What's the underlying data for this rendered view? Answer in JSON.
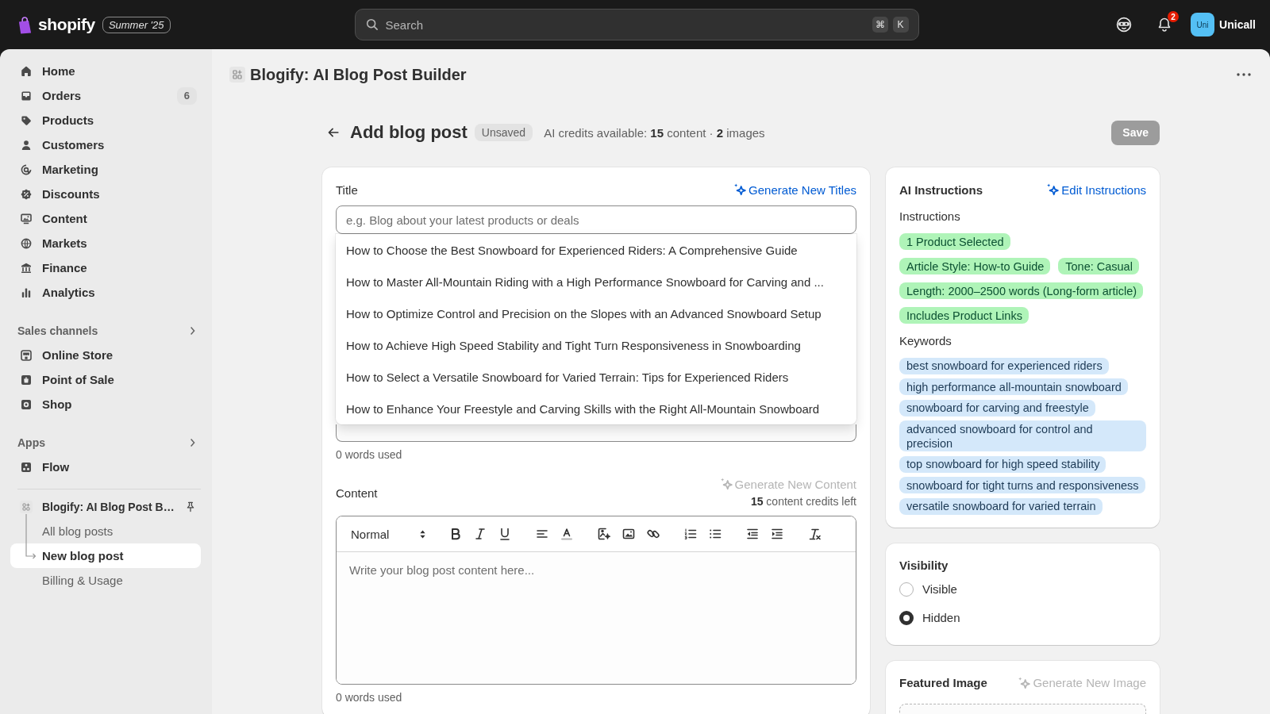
{
  "top_bar": {
    "logo_text": "shopify",
    "edition_badge": "Summer '25",
    "search": {
      "placeholder": "Search",
      "shortcut_keys": [
        "⌘",
        "K"
      ]
    },
    "notification_count": "2",
    "avatar_initials": "Uni",
    "store_name": "Unicall"
  },
  "sidebar": {
    "items": [
      {
        "label": "Home",
        "selected": false
      },
      {
        "label": "Orders",
        "badge": "6",
        "selected": false
      },
      {
        "label": "Products",
        "selected": false
      },
      {
        "label": "Customers",
        "selected": false
      },
      {
        "label": "Marketing",
        "selected": false
      },
      {
        "label": "Discounts",
        "selected": false
      },
      {
        "label": "Content",
        "selected": false
      },
      {
        "label": "Markets",
        "selected": false
      },
      {
        "label": "Finance",
        "selected": false
      },
      {
        "label": "Analytics",
        "selected": false
      }
    ],
    "sections": [
      {
        "title": "Sales channels",
        "items": [
          {
            "label": "Online Store",
            "selected": false
          },
          {
            "label": "Point of Sale",
            "selected": false
          },
          {
            "label": "Shop",
            "selected": false
          }
        ]
      },
      {
        "title": "Apps",
        "items": [
          {
            "label": "Flow",
            "selected": false
          }
        ]
      }
    ],
    "app": {
      "label": "Blogify: AI Blog Post B…",
      "selected": false,
      "children": [
        {
          "label": "All blog posts",
          "selected": false
        },
        {
          "label": "New blog post",
          "selected": true
        },
        {
          "label": "Billing & Usage",
          "selected": false
        }
      ]
    }
  },
  "app_header": {
    "title": "Blogify: AI Blog Post Builder"
  },
  "page_header": {
    "title": "Add blog post",
    "status_badge": "Unsaved",
    "credits_text": "AI credits available: **15** content · **2** images",
    "save_button": {
      "label": "Save",
      "disabled": true
    }
  },
  "post_form": {
    "title_field": {
      "label": "Title",
      "generate_link": {
        "label": "Generate New Titles",
        "disabled": false
      },
      "placeholder": "e.g. Blog about your latest products or deals",
      "suggestions": [
        "How to Choose the Best Snowboard for Experienced Riders: A Comprehensive Guide",
        "How to Master All-Mountain Riding with a High Performance Snowboard for Carving and ...",
        "How to Optimize Control and Precision on the Slopes with an Advanced Snowboard Setup",
        "How to Achieve High Speed Stability and Tight Turn Responsiveness in Snowboarding",
        "How to Select a Versatile Snowboard for Varied Terrain: Tips for Experienced Riders",
        "How to Enhance Your Freestyle and Carving Skills with the Right All-Mountain Snowboard"
      ]
    },
    "covered_field": {
      "word_count": "0 words used"
    },
    "content_field": {
      "label": "Content",
      "generate_link": {
        "label": "Generate New Content",
        "disabled": true
      },
      "credits_text": "**15** content credits left",
      "format_select": "Normal",
      "placeholder": "Write your blog post content here...",
      "word_count": "0 words used"
    }
  },
  "ai_instructions": {
    "title": "AI Instructions",
    "edit_link": {
      "label": "Edit Instructions",
      "disabled": false
    },
    "instructions_label": "Instructions",
    "instructions": [
      "1 Product Selected",
      "Article Style: How-to Guide",
      "Tone: Casual",
      "Length: 2000–2500 words (Long-form article)",
      "Includes Product Links"
    ],
    "keywords_label": "Keywords",
    "keywords": [
      "best snowboard for experienced riders",
      "high performance all-mountain snowboard",
      "snowboard for carving and freestyle",
      "advanced snowboard for control and precision",
      "top snowboard for high speed stability",
      "snowboard for tight turns and responsiveness",
      "versatile snowboard for varied terrain"
    ]
  },
  "visibility": {
    "title": "Visibility",
    "options": [
      {
        "label": "Visible",
        "selected": false
      },
      {
        "label": "Hidden",
        "selected": true
      }
    ]
  },
  "featured_image": {
    "title": "Featured Image",
    "generate_link": {
      "label": "Generate New Image",
      "disabled": true
    }
  }
}
